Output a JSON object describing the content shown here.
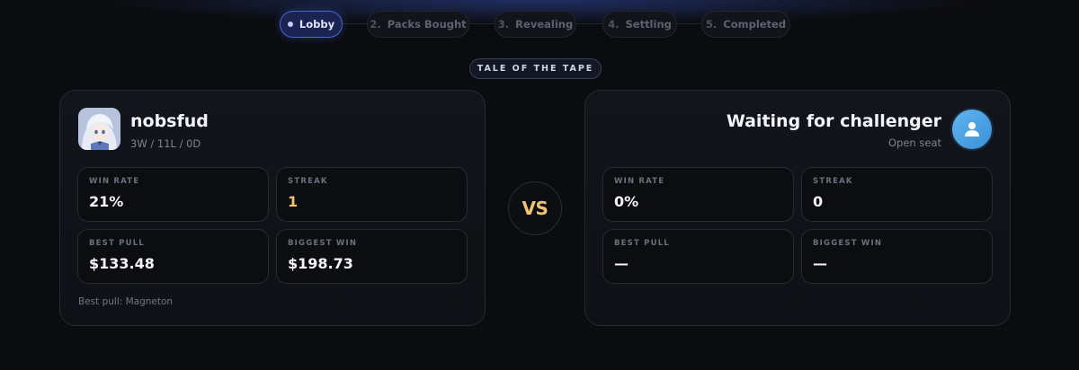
{
  "steps": [
    {
      "number": "",
      "label": "Lobby",
      "active": true
    },
    {
      "number": "2.",
      "label": "Packs Bought",
      "active": false
    },
    {
      "number": "3.",
      "label": "Revealing",
      "active": false
    },
    {
      "number": "4.",
      "label": "Settling",
      "active": false
    },
    {
      "number": "5.",
      "label": "Completed",
      "active": false
    }
  ],
  "tape_label": "TALE OF THE TAPE",
  "vs_label": "VS",
  "player": {
    "name": "nobsfud",
    "record": "3W / 11L / 0D",
    "stats": [
      {
        "label": "WIN RATE",
        "value": "21%"
      },
      {
        "label": "STREAK",
        "value": "1"
      },
      {
        "label": "BEST PULL",
        "value": "$133.48"
      },
      {
        "label": "BIGGEST WIN",
        "value": "$198.73"
      }
    ],
    "footnote": "Best pull: Magneton"
  },
  "challenger": {
    "title": "Waiting for challenger",
    "subtitle": "Open seat",
    "avatar_icon": "user-icon",
    "stats": [
      {
        "label": "WIN RATE",
        "value": "0%"
      },
      {
        "label": "STREAK",
        "value": "0"
      },
      {
        "label": "BEST PULL",
        "value": "—"
      },
      {
        "label": "BIGGEST WIN",
        "value": "—"
      }
    ]
  },
  "colors": {
    "accent_active": "#1a2352",
    "streak_gold": "#f2c46d",
    "vs_gold": "#efc36f",
    "open_avatar": "#4aa2e6"
  }
}
